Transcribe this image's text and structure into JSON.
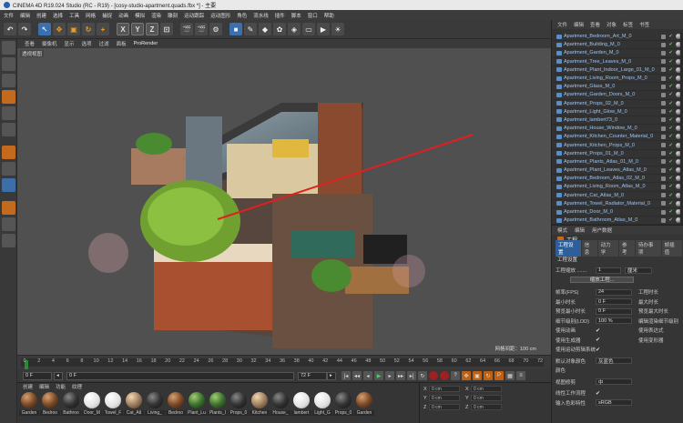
{
  "window": {
    "title": "CINEMA 4D R19.024 Studio (RC - R19) - [cosy-studio-apartment.quads.fbx *] - 主要"
  },
  "menubar": {
    "items": [
      "文件",
      "编辑",
      "创建",
      "选择",
      "工具",
      "网格",
      "捕捉",
      "动画",
      "模拟",
      "渲染",
      "雕刻",
      "运动跟踪",
      "运动图形",
      "角色",
      "流水线",
      "插件",
      "脚本",
      "窗口",
      "帮助"
    ]
  },
  "toolbar": {
    "axis_x": "X",
    "axis_y": "Y",
    "axis_z": "Z"
  },
  "viewport": {
    "menu": [
      "查看",
      "摄像机",
      "显示",
      "选项",
      "过滤",
      "面板",
      "ProRender"
    ],
    "label": "透视视图",
    "grid_info": "网格间距：100 cm"
  },
  "timeline": {
    "ticks": [
      "0",
      "2",
      "4",
      "6",
      "8",
      "10",
      "12",
      "14",
      "16",
      "18",
      "20",
      "22",
      "24",
      "26",
      "28",
      "30",
      "32",
      "34",
      "36",
      "38",
      "40",
      "42",
      "44",
      "46",
      "48",
      "50",
      "52",
      "54",
      "56",
      "58",
      "60",
      "62",
      "64",
      "66",
      "68",
      "70",
      "72"
    ],
    "current_frame": "0 F",
    "start_frame": "0 F",
    "end_frame": "72 F",
    "end_frame2": "72 F",
    "frame_display": "0 F"
  },
  "material_manager": {
    "menu": [
      "创建",
      "编辑",
      "功能",
      "纹理"
    ],
    "materials": [
      {
        "name": "Garden",
        "kind": "brown"
      },
      {
        "name": "Bedroo",
        "kind": "brown"
      },
      {
        "name": "Bathroo",
        "kind": "dark"
      },
      {
        "name": "Door_M",
        "kind": "white"
      },
      {
        "name": "Towel_F",
        "kind": "white"
      },
      {
        "name": "Cat_Atl",
        "kind": "tan"
      },
      {
        "name": "Living_",
        "kind": "dark"
      },
      {
        "name": "Bedroo",
        "kind": "brown"
      },
      {
        "name": "Plant_Lu",
        "kind": "green"
      },
      {
        "name": "Plants_I",
        "kind": "green"
      },
      {
        "name": "Props_0",
        "kind": "dark"
      },
      {
        "name": "Kitchen",
        "kind": "tan"
      },
      {
        "name": "House_",
        "kind": "dark"
      },
      {
        "name": "lambert",
        "kind": "white"
      },
      {
        "name": "Light_G",
        "kind": "white"
      },
      {
        "name": "Props_0",
        "kind": "dark"
      },
      {
        "name": "Garden",
        "kind": "brown"
      }
    ]
  },
  "coords": {
    "x": "X",
    "y": "Y",
    "z": "Z",
    "val": "0 cm"
  },
  "object_manager": {
    "menu": [
      "文件",
      "编辑",
      "查看",
      "对象",
      "标签",
      "书签"
    ],
    "objects": [
      "Apartment_Bedroom_Art_M_0",
      "Apartment_Building_M_0",
      "Apartment_Garden_M_0",
      "Apartment_Tree_Leaves_M_0",
      "Apartment_Plant_Indoor_Large_01_M_0",
      "Apartment_Living_Room_Props_M_0",
      "Apartment_Glass_M_0",
      "Apartment_Garden_Doors_M_0",
      "Apartment_Props_02_M_0",
      "Apartment_Light_Glow_M_0",
      "Apartment_lambert73_0",
      "Apartment_House_Window_M_0",
      "Apartment_Kitchen_Counter_Material_0",
      "Apartment_Kitchen_Props_M_0",
      "Apartment_Props_01_M_0",
      "Apartment_Plants_Atlas_01_M_0",
      "Apartment_Plant_Leaves_Atlas_M_0",
      "Apartment_Bedroom_Atlas_02_M_0",
      "Apartment_Living_Room_Atlas_M_0",
      "Apartment_Cat_Atlas_M_0",
      "Apartment_Towel_Radiator_Material_0",
      "Apartment_Door_M_0",
      "Apartment_Bathroom_Atlas_M_0"
    ]
  },
  "attributes": {
    "menu": [
      "模式",
      "编辑",
      "用户数据"
    ],
    "title": "工程",
    "tabs": [
      "工程设置",
      "信息",
      "动力学",
      "参考",
      "待办事项",
      "帧插值"
    ],
    "section": "工程设置",
    "scale_label": "工程缩放 .......",
    "scale_value": "1",
    "scale_unit": "厘米",
    "scale_button": "缩放工程...",
    "fps_label": "帧率(FPS)",
    "fps_value": "24",
    "project_time_label": "工程时长",
    "min_time_label": "最小时长",
    "min_time_value": "0 F",
    "max_time_label": "最大时长",
    "preview_min_label": "预览最小时长",
    "preview_min_value": "0 F",
    "preview_max_label": "预览最大时长",
    "lod_label": "细节级别(LOD)",
    "lod_value": "100 %",
    "lod_edit_label": "编辑渲染细节级别",
    "use_anim_label": "使用动画",
    "use_expr_label": "使用表达式",
    "use_gen_label": "使用生成器",
    "use_deform_label": "使用变形器",
    "use_motion_label": "使用运动剪辑系统",
    "default_color_label": "默认对象颜色",
    "default_color_value": "灰蓝色",
    "color_label": "颜色",
    "view_clip_label": "视图修剪",
    "view_clip_value": "中",
    "linear_label": "线性工作流程",
    "input_color_label": "输入色彩特性",
    "input_color_value": "sRGB"
  }
}
